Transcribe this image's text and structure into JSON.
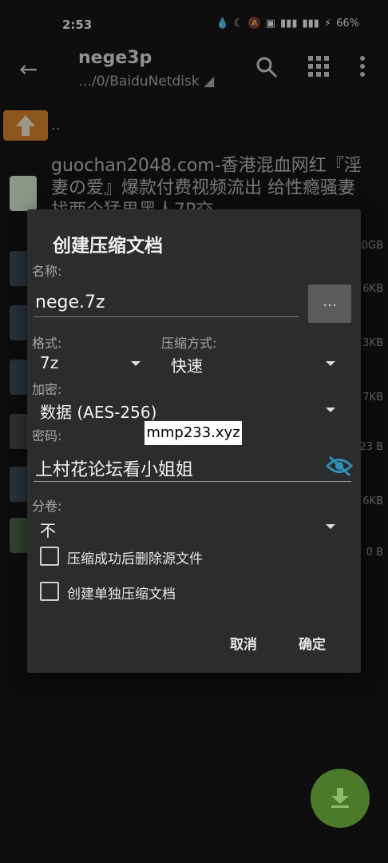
{
  "status_bar": {
    "time": "2:53",
    "battery": "66%"
  },
  "app_bar": {
    "title": "nege3p",
    "path": "…/0/BaiduNetdisk"
  },
  "file_list": {
    "parent_label": "..",
    "first_file_name": "guochan2048.com-香港混血网红『淫妻の爱』爆款付费视频流出 给性瘾骚妻找两个猛男黑人7P交",
    "sizes": [
      "0GB",
      "6KB",
      "3KB",
      "7KB",
      "23 B",
      "6KB",
      "0 B"
    ]
  },
  "dialog": {
    "title": "创建压缩文档",
    "name_label": "名称:",
    "name_value": "nege.7z",
    "ellipsis_label": "...",
    "format_label": "格式:",
    "format_value": "7z",
    "method_label": "压缩方式:",
    "method_value": "快速",
    "encryption_label": "加密:",
    "encryption_value": "数据 (AES-256)",
    "password_label": "密码:",
    "password_value": "上村花论坛看小姐姐",
    "split_label": "分卷:",
    "split_value": "不",
    "delete_source_label": "压缩成功后删除源文件",
    "separate_archive_label": "创建单独压缩文档",
    "cancel_label": "取消",
    "ok_label": "确定"
  },
  "watermark": "mmp233.xyz",
  "colors": {
    "dialog_bg": "#2a2c2e",
    "accent_icon": "#2f8fb8",
    "fab": "#4a7a2a"
  }
}
